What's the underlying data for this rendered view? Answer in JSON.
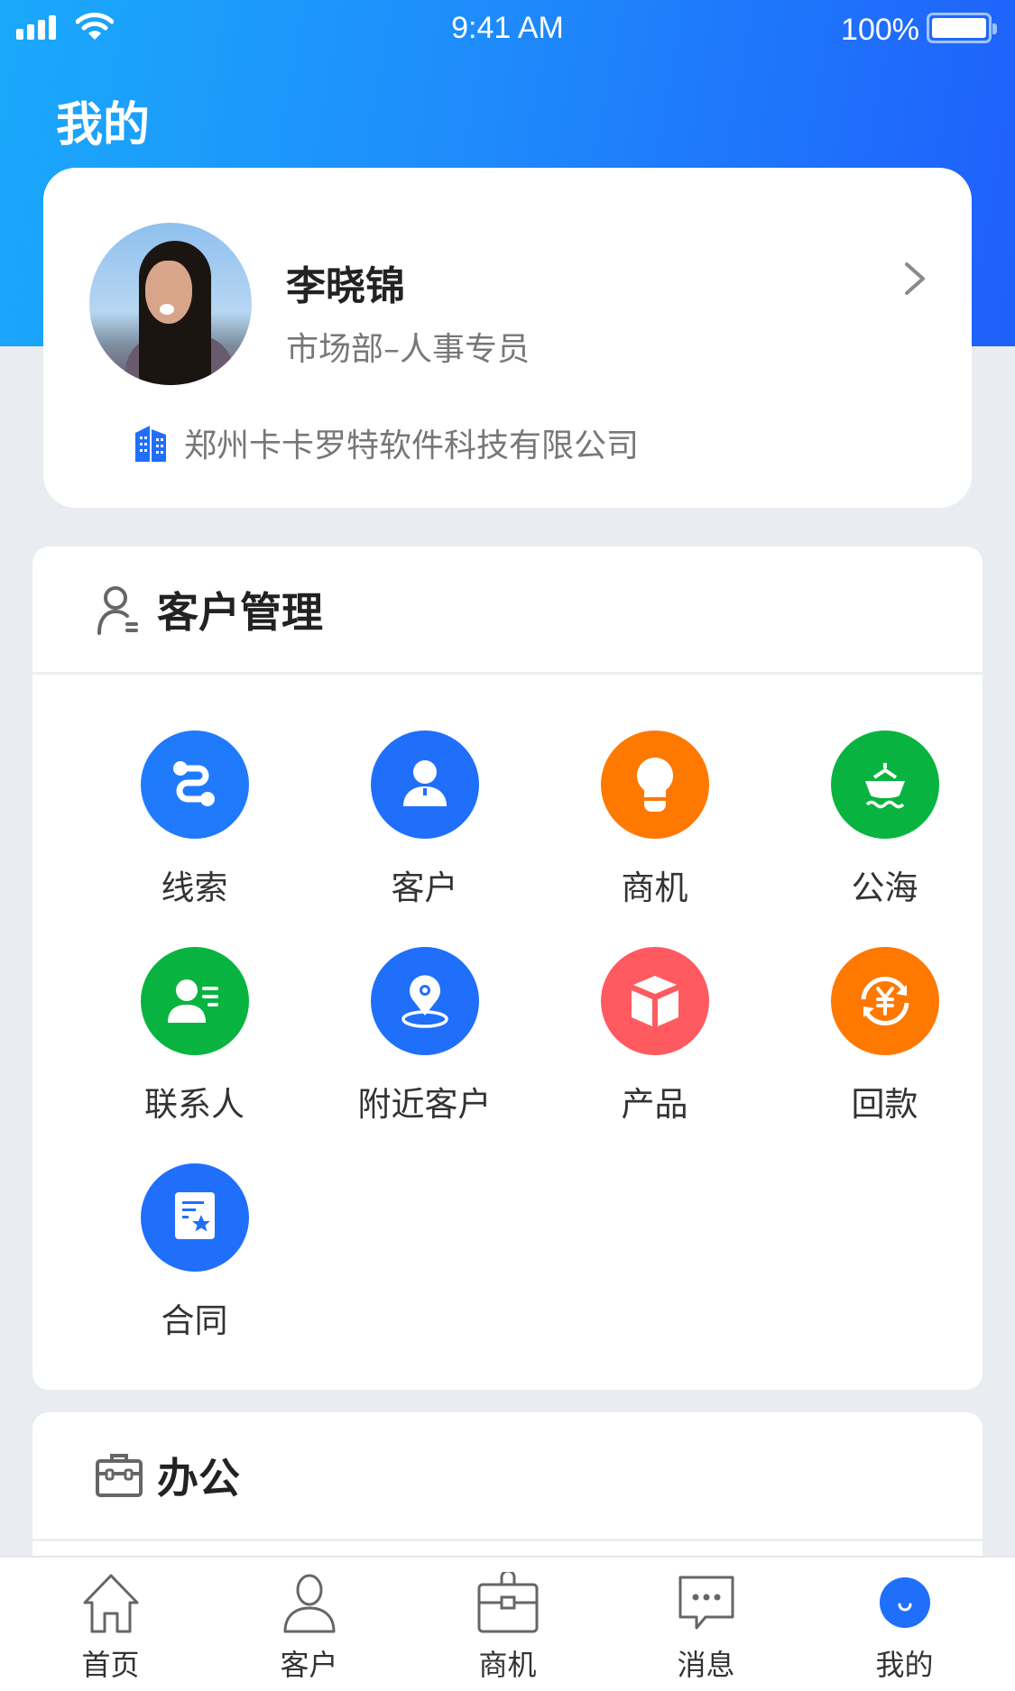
{
  "status_bar": {
    "time": "9:41 AM",
    "battery_percent": "100%",
    "battery_level": 1.0,
    "signal_icon": "signal-bars-icon",
    "wifi_icon": "wifi-icon",
    "battery_icon": "battery-icon"
  },
  "header": {
    "title": "我的"
  },
  "colors": {
    "gradient_start": "#1aa9fb",
    "gradient_end": "#1f5ffb",
    "blue": "#1f6ffb",
    "orange": "#ff7800",
    "green": "#08b43f",
    "red": "#ff5a5f",
    "page_bg": "#e9edf1"
  },
  "profile": {
    "name": "李晓锦",
    "department": "市场部–人事专员",
    "company": "郑州卡卡罗特软件科技有限公司",
    "company_icon": "building-icon",
    "chevron_icon": "chevron-right-icon"
  },
  "crm_section": {
    "title": "客户管理",
    "icon": "user-manage-icon",
    "items": [
      {
        "label": "线索",
        "icon": "leads-path-icon",
        "color": "#1f7bfb"
      },
      {
        "label": "客户",
        "icon": "customer-icon",
        "color": "#1f6ffb"
      },
      {
        "label": "商机",
        "icon": "lightbulb-icon",
        "color": "#ff7800"
      },
      {
        "label": "公海",
        "icon": "ship-icon",
        "color": "#08b43f"
      },
      {
        "label": "联系人",
        "icon": "contact-card-icon",
        "color": "#08b43f"
      },
      {
        "label": "附近客户",
        "icon": "location-pin-icon",
        "color": "#1f6ffb"
      },
      {
        "label": "产品",
        "icon": "cube-icon",
        "color": "#ff5a5f"
      },
      {
        "label": "回款",
        "icon": "yuan-refresh-icon",
        "color": "#ff7800"
      },
      {
        "label": "合同",
        "icon": "contract-icon",
        "color": "#1f6ffb"
      }
    ]
  },
  "office_section": {
    "title": "办公",
    "icon": "briefcase-icon"
  },
  "tabbar": {
    "active_index": 4,
    "items": [
      {
        "label": "首页",
        "icon": "home-icon"
      },
      {
        "label": "客户",
        "icon": "person-icon"
      },
      {
        "label": "商机",
        "icon": "briefcase-icon"
      },
      {
        "label": "消息",
        "icon": "message-icon"
      },
      {
        "label": "我的",
        "icon": "smile-face-icon"
      }
    ]
  }
}
